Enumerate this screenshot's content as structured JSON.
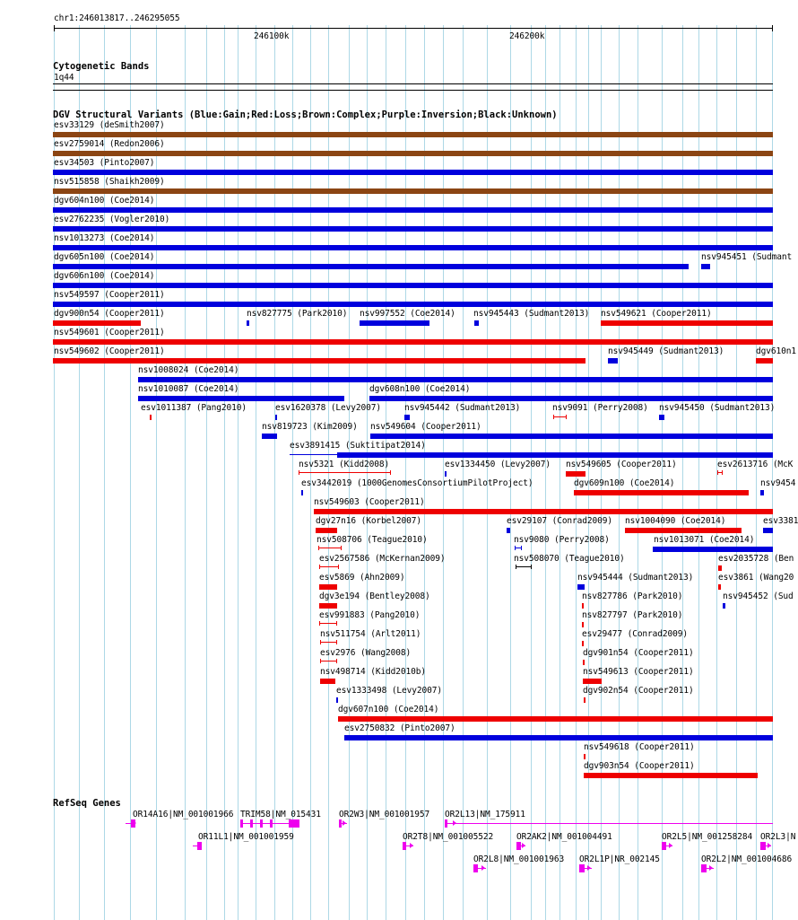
{
  "locus": "chr1:246013817..246295055",
  "ruler": {
    "ticks": [
      "246100k",
      "246200k"
    ]
  },
  "cyto": {
    "title": "Cytogenetic Bands",
    "band": "1q44"
  },
  "dgv": {
    "title": "DGV Structural Variants (Blue:Gain;Red:Loss;Brown:Complex;Purple:Inversion;Black:Unknown)",
    "features": [
      {
        "label": "esv33129 (deSmith2007)",
        "type": "complex"
      },
      {
        "label": "esv2759014 (Redon2006)",
        "type": "complex"
      },
      {
        "label": "esv34503 (Pinto2007)",
        "type": "gain"
      },
      {
        "label": "nsv515858 (Shaikh2009)",
        "type": "complex"
      },
      {
        "label": "dgv604n100 (Coe2014)",
        "type": "gain"
      },
      {
        "label": "esv2762235 (Vogler2010)",
        "type": "gain"
      },
      {
        "label": "nsv1013273 (Coe2014)",
        "type": "gain"
      },
      {
        "label": "dgv605n100 (Coe2014)",
        "type": "gain"
      },
      {
        "label": "nsv945451 (Sudmant",
        "type": "gain"
      },
      {
        "label": "dgv606n100 (Coe2014)",
        "type": "gain"
      },
      {
        "label": "nsv549597 (Cooper2011)",
        "type": "gain"
      },
      {
        "label": "dgv900n54 (Cooper2011)",
        "type": "loss"
      },
      {
        "label": "nsv827775 (Park2010)",
        "type": "gain"
      },
      {
        "label": "nsv997552 (Coe2014)",
        "type": "gain"
      },
      {
        "label": "nsv945443 (Sudmant2013)",
        "type": "gain"
      },
      {
        "label": "nsv549621 (Cooper2011)",
        "type": "loss"
      },
      {
        "label": "nsv549601 (Cooper2011)",
        "type": "loss"
      },
      {
        "label": "nsv549602 (Cooper2011)",
        "type": "loss"
      },
      {
        "label": "nsv945449 (Sudmant2013)",
        "type": "gain"
      },
      {
        "label": "dgv610n1",
        "type": "loss"
      },
      {
        "label": "nsv1008024 (Coe2014)",
        "type": "gain"
      },
      {
        "label": "nsv1010087 (Coe2014)",
        "type": "gain"
      },
      {
        "label": "dgv608n100 (Coe2014)",
        "type": "gain"
      },
      {
        "label": "esv1011387 (Pang2010)",
        "type": "loss"
      },
      {
        "label": "esv1620378 (Levy2007)",
        "type": "gain"
      },
      {
        "label": "nsv945442 (Sudmant2013)",
        "type": "gain"
      },
      {
        "label": "nsv9091 (Perry2008)",
        "type": "loss"
      },
      {
        "label": "nsv945450 (Sudmant2013)",
        "type": "gain"
      },
      {
        "label": "nsv819723 (Kim2009)",
        "type": "gain"
      },
      {
        "label": "nsv549604 (Cooper2011)",
        "type": "gain"
      },
      {
        "label": "esv3891415 (Suktitipat2014)",
        "type": "gain"
      },
      {
        "label": "nsv5321 (Kidd2008)",
        "type": "loss"
      },
      {
        "label": "esv1334450 (Levy2007)",
        "type": "gain"
      },
      {
        "label": "nsv549605 (Cooper2011)",
        "type": "loss"
      },
      {
        "label": "esv2613716 (McK",
        "type": "loss"
      },
      {
        "label": "esv3442019 (1000GenomesConsortiumPilotProject)",
        "type": "gain"
      },
      {
        "label": "dgv609n100 (Coe2014)",
        "type": "loss"
      },
      {
        "label": "nsv9454",
        "type": "gain"
      },
      {
        "label": "nsv549603 (Cooper2011)",
        "type": "loss"
      },
      {
        "label": "dgv27n16 (Korbel2007)",
        "type": "loss"
      },
      {
        "label": "esv29107 (Conrad2009)",
        "type": "gain"
      },
      {
        "label": "nsv1004090 (Coe2014)",
        "type": "loss"
      },
      {
        "label": "esv3381",
        "type": "gain"
      },
      {
        "label": "nsv508706 (Teague2010)",
        "type": "loss"
      },
      {
        "label": "nsv9080 (Perry2008)",
        "type": "gain"
      },
      {
        "label": "nsv1013071 (Coe2014)",
        "type": "gain"
      },
      {
        "label": "esv2567586 (McKernan2009)",
        "type": "loss"
      },
      {
        "label": "nsv508070 (Teague2010)",
        "type": "unknown"
      },
      {
        "label": "esv2035728 (Ben",
        "type": "loss"
      },
      {
        "label": "esv5869 (Ahn2009)",
        "type": "loss"
      },
      {
        "label": "nsv945444 (Sudmant2013)",
        "type": "gain"
      },
      {
        "label": "esv3861 (Wang20",
        "type": "loss"
      },
      {
        "label": "dgv3e194 (Bentley2008)",
        "type": "loss"
      },
      {
        "label": "nsv827786 (Park2010)",
        "type": "loss"
      },
      {
        "label": "nsv945452 (Sud",
        "type": "gain"
      },
      {
        "label": "esv991883 (Pang2010)",
        "type": "loss"
      },
      {
        "label": "nsv827797 (Park2010)",
        "type": "loss"
      },
      {
        "label": "nsv511754 (Arlt2011)",
        "type": "loss"
      },
      {
        "label": "esv29477 (Conrad2009)",
        "type": "loss"
      },
      {
        "label": "esv2976 (Wang2008)",
        "type": "loss"
      },
      {
        "label": "dgv901n54 (Cooper2011)",
        "type": "loss"
      },
      {
        "label": "nsv498714 (Kidd2010b)",
        "type": "loss"
      },
      {
        "label": "nsv549613 (Cooper2011)",
        "type": "loss"
      },
      {
        "label": "esv1333498 (Levy2007)",
        "type": "gain"
      },
      {
        "label": "dgv902n54 (Cooper2011)",
        "type": "loss"
      },
      {
        "label": "dgv607n100 (Coe2014)",
        "type": "loss"
      },
      {
        "label": "esv2750832 (Pinto2007)",
        "type": "gain"
      },
      {
        "label": "nsv549618 (Cooper2011)",
        "type": "loss"
      },
      {
        "label": "dgv903n54 (Cooper2011)",
        "type": "loss"
      }
    ]
  },
  "refseq": {
    "title": "RefSeq Genes",
    "genes": [
      {
        "label": "OR14A16|NM_001001966"
      },
      {
        "label": "TRIM58|NM_015431"
      },
      {
        "label": "OR2W3|NM_001001957"
      },
      {
        "label": "OR2L13|NM_175911"
      },
      {
        "label": "OR11L1|NM_001001959"
      },
      {
        "label": "OR2T8|NM_001005522"
      },
      {
        "label": "OR2AK2|NM_001004491"
      },
      {
        "label": "OR2L5|NM_001258284"
      },
      {
        "label": "OR2L3|N"
      },
      {
        "label": "OR2L8|NM_001001963"
      },
      {
        "label": "OR2L1P|NR_002145"
      },
      {
        "label": "OR2L2|NM_001004686"
      }
    ]
  },
  "colors": {
    "gain": "#0000dd",
    "loss": "#ee0000",
    "complex": "#8b4513",
    "unknown": "#000000",
    "gene": "#ee00ee",
    "grid": "#add8e6"
  }
}
